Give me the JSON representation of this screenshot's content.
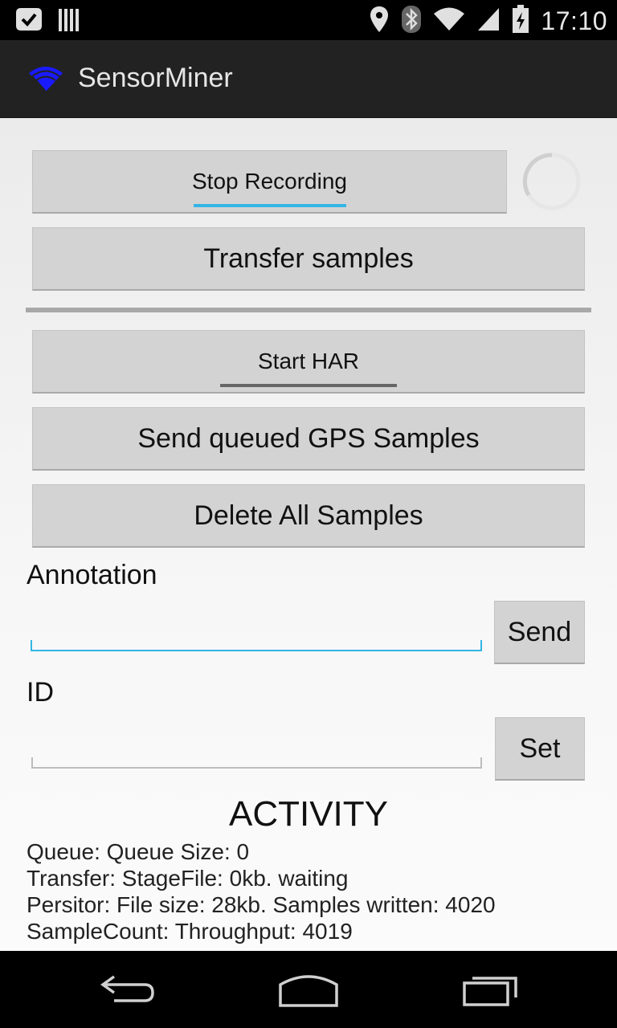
{
  "status_bar": {
    "time": "17:10",
    "icons": [
      "notification-chat-icon",
      "barcode-icon",
      "location-icon",
      "bluetooth-icon",
      "wifi-icon",
      "signal-icon",
      "battery-charging-icon"
    ]
  },
  "action_bar": {
    "title": "SensorMiner",
    "icon": "wifi-icon"
  },
  "buttons": {
    "stop_recording": "Stop Recording",
    "transfer_samples": "Transfer samples",
    "start_har": "Start HAR",
    "send_gps": "Send queued GPS Samples",
    "delete_all": "Delete All Samples",
    "send": "Send",
    "set": "Set"
  },
  "toggle_states": {
    "stop_recording_on": true,
    "start_har_on": false
  },
  "annotation": {
    "label": "Annotation",
    "value": ""
  },
  "id_field": {
    "label": "ID",
    "value": ""
  },
  "activity": {
    "heading": "ACTIVITY",
    "lines": [
      "Queue: Queue Size: 0",
      "Transfer: StageFile: 0kb. waiting",
      "Persitor: File size: 28kb. Samples written: 4020",
      "SampleCount: Throughput: 4019"
    ]
  },
  "colors": {
    "accent": "#33b5e5",
    "toggle_off": "#666666",
    "action_bar": "#222222",
    "app_icon": "#1a1aff"
  },
  "nav_bar": {
    "icons": [
      "back-icon",
      "home-icon",
      "recent-apps-icon"
    ]
  }
}
